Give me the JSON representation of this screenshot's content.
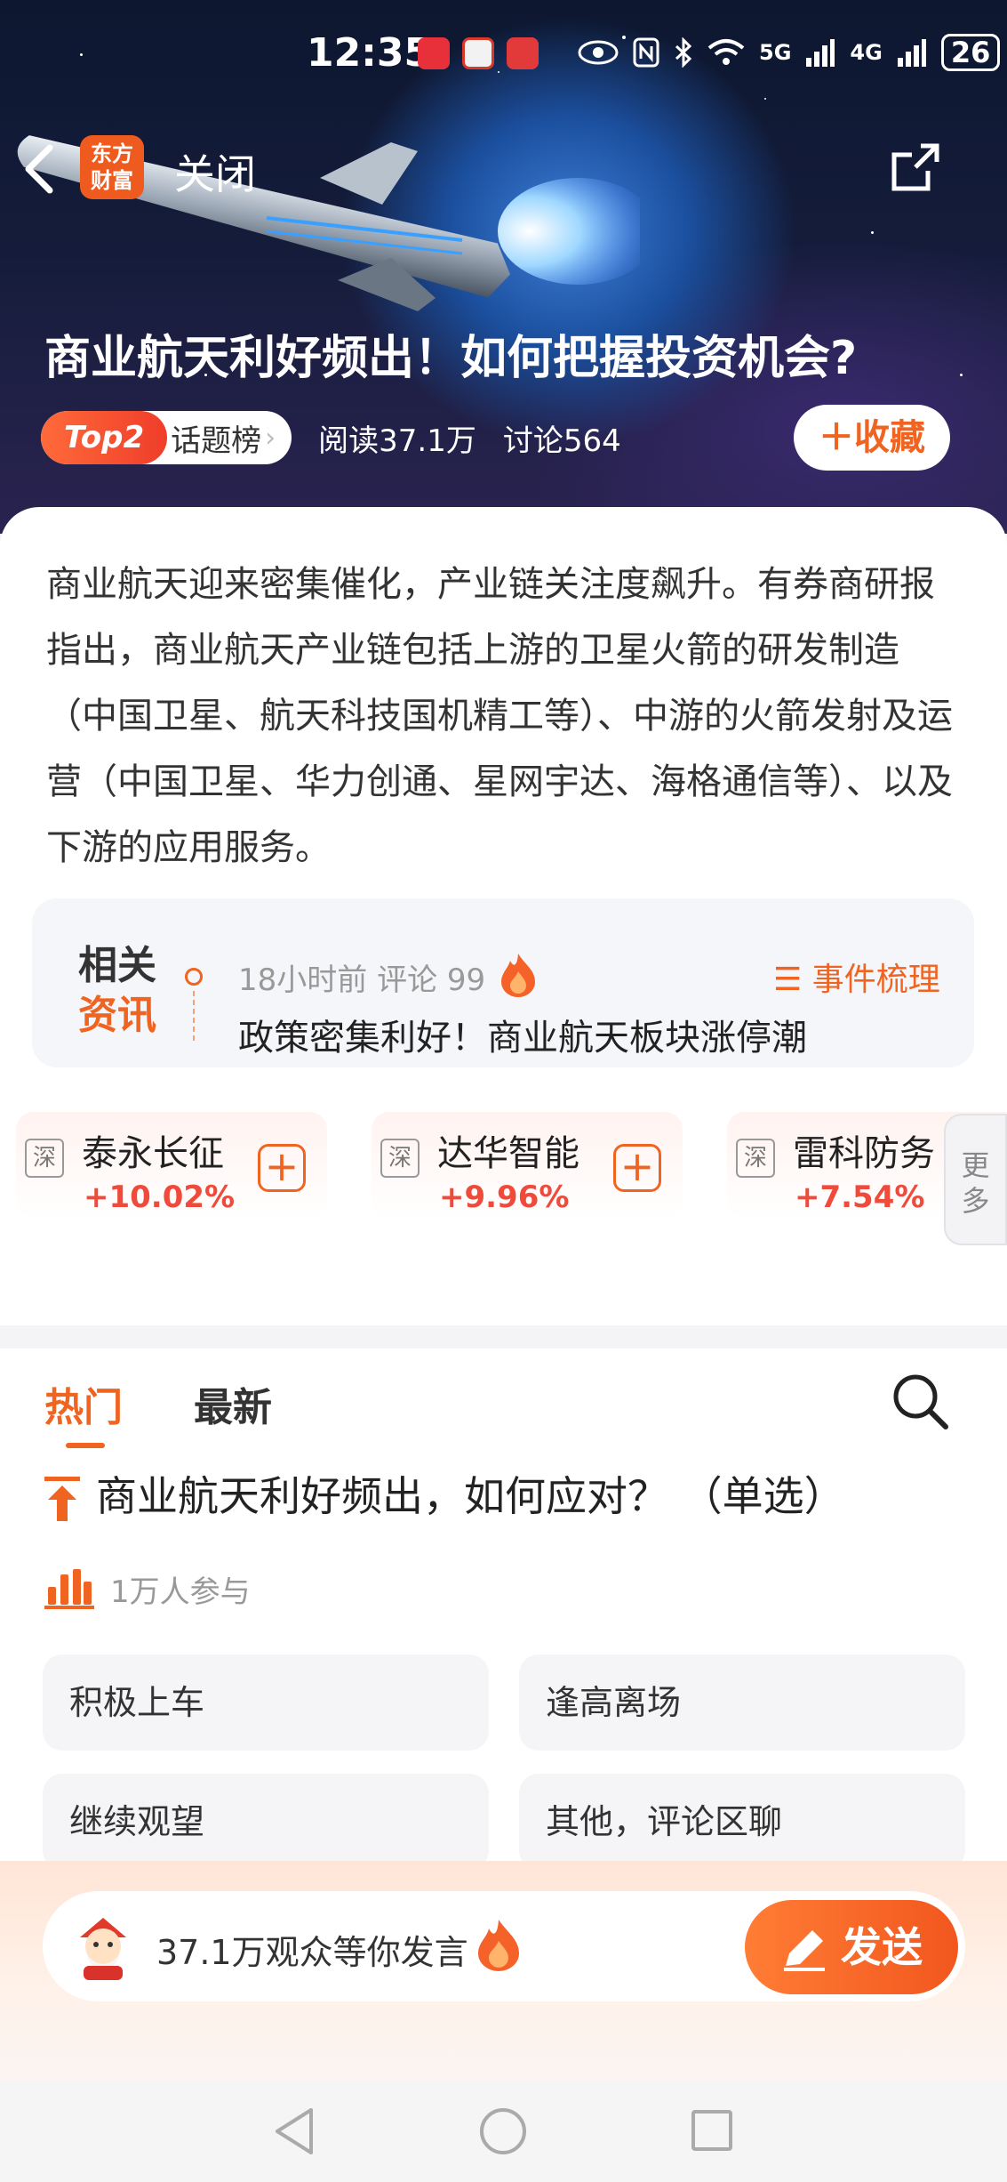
{
  "status_bar": {
    "time": "12:35",
    "network_5g": "5G",
    "network_4g": "4G",
    "battery": "26",
    "colors": {
      "huawei": "#e8303a",
      "app2": "#d83a2a",
      "app3": "#e23a3a"
    }
  },
  "header": {
    "app_logo_line1": "东方",
    "app_logo_line2": "财富",
    "close_label": "关闭",
    "title": "商业航天利好频出！如何把握投资机会?"
  },
  "meta": {
    "rank": "Top2",
    "rank_label": "话题榜",
    "reads": "阅读37.1万",
    "discuss": "讨论564",
    "favorite_label": "收藏"
  },
  "intro": {
    "text": "商业航天迎来密集催化，产业链关注度飙升。有券商研报指出，商业航天产业链包括上游的卫星火箭的研发制造（中国卫星、航天科技国机精工等）、中游的火箭发射及运营（中国卫星、华力创通、星网宇达、海格通信等）、以及下游的应用服务。"
  },
  "news": {
    "tag_line1": "相关",
    "tag_line2": "资讯",
    "meta": "18小时前 评论 99",
    "events_label": "事件梳理",
    "headline": "政策密集利好！商业航天板块涨停潮"
  },
  "stocks": [
    {
      "market": "深",
      "name": "泰永长征",
      "change": "+10.02%"
    },
    {
      "market": "深",
      "name": "达华智能",
      "change": "+9.96%"
    },
    {
      "market": "深",
      "name": "雷科防务",
      "change": "+7.54%"
    }
  ],
  "more_label_1": "更",
  "more_label_2": "多",
  "tabs": {
    "hot": "热门",
    "latest": "最新"
  },
  "poll": {
    "title": "商业航天利好频出，如何应对？ （单选）",
    "participants": "1万人参与",
    "options": [
      "积极上车",
      "逢高离场",
      "继续观望",
      "其他，评论区聊"
    ]
  },
  "comment": {
    "placeholder": "37.1万观众等你发言",
    "send_label": "发送"
  },
  "accent_color": "#f06422"
}
